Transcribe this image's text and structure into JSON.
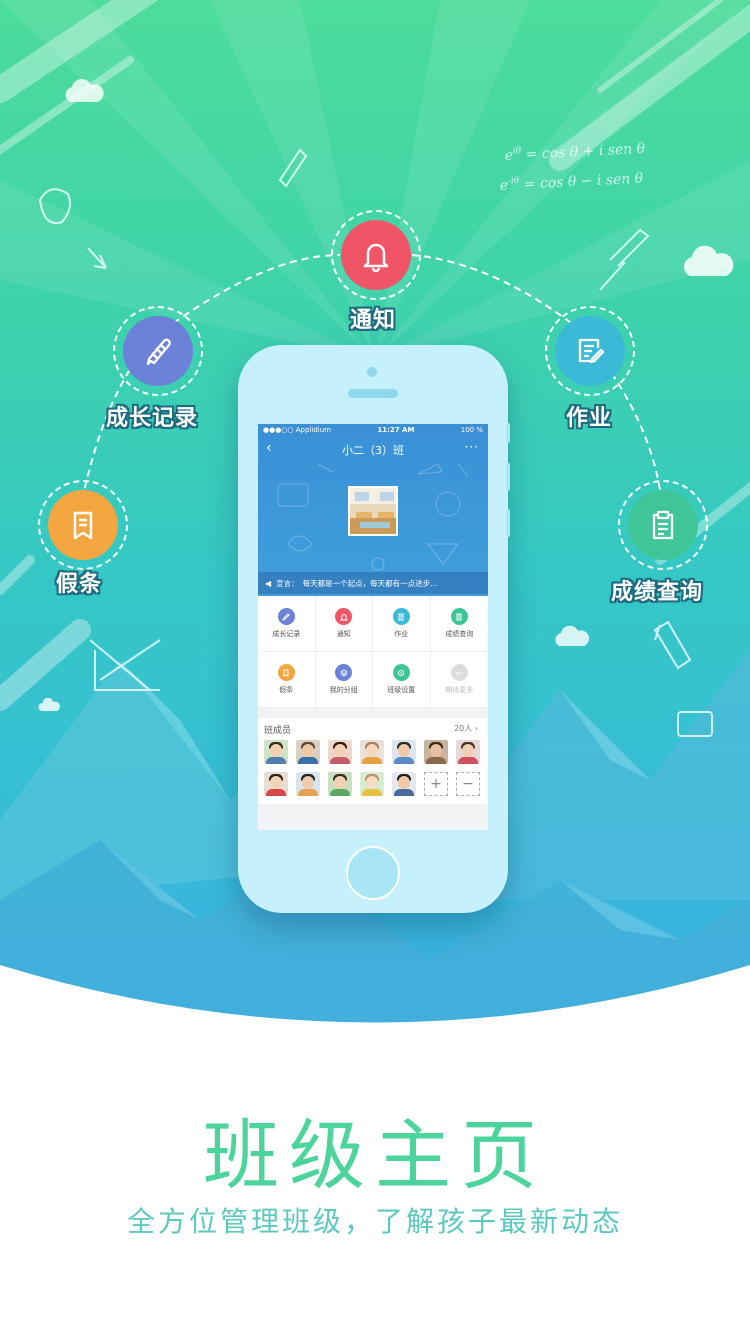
{
  "features": {
    "notice": {
      "label": "通知",
      "icon": "bell-icon",
      "color": "#ef5566"
    },
    "growth": {
      "label": "成长记录",
      "icon": "pencil-icon",
      "color": "#6b82d8"
    },
    "homework": {
      "label": "作业",
      "icon": "document-edit-icon",
      "color": "#3db9d8"
    },
    "leave": {
      "label": "假条",
      "icon": "bookmark-note-icon",
      "color": "#f3a640"
    },
    "grades": {
      "label": "成绩查询",
      "icon": "clipboard-icon",
      "color": "#3fc598"
    }
  },
  "phone": {
    "status": {
      "carrier": "●●●○○ Applidium",
      "time": "11:27 AM",
      "battery": "100 %"
    },
    "header": {
      "title": "小二（3）班",
      "back": "‹",
      "more": "···"
    },
    "announcement": {
      "label": "宣言：",
      "text": "每天都是一个起点，每天都有一点进步..."
    },
    "grid": [
      {
        "label": "成长记录",
        "icon": "pencil-icon",
        "color": "#6b82d8"
      },
      {
        "label": "通知",
        "icon": "bell-icon",
        "color": "#ef5566"
      },
      {
        "label": "作业",
        "icon": "document-edit-icon",
        "color": "#3db9d8"
      },
      {
        "label": "成绩查询",
        "icon": "clipboard-icon",
        "color": "#3fc598"
      },
      {
        "label": "假条",
        "icon": "bookmark-note-icon",
        "color": "#f3a640"
      },
      {
        "label": "我的分组",
        "icon": "layers-icon",
        "color": "#6b82d8"
      },
      {
        "label": "班级设置",
        "icon": "gear-icon",
        "color": "#3fc598"
      },
      {
        "label": "期待更多",
        "icon": "more-icon",
        "color": "#dddddd"
      }
    ],
    "members": {
      "title": "班成员",
      "count": "20人 ›",
      "add": "+",
      "remove": "−"
    }
  },
  "page": {
    "title": "班级主页",
    "subtitle": "全方位管理班级，了解孩子最新动态"
  }
}
